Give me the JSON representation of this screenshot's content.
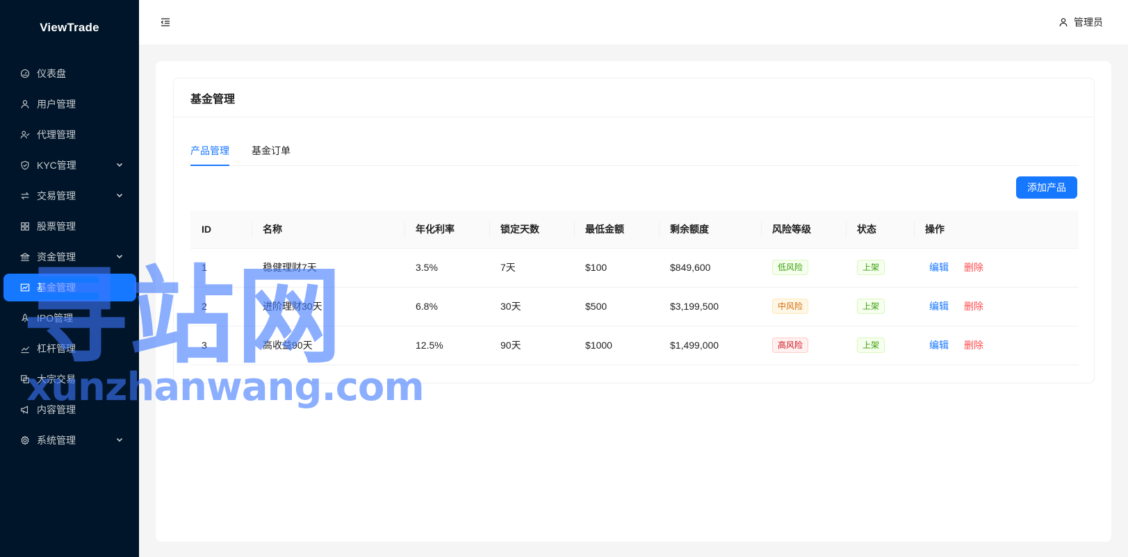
{
  "brand": "ViewTrade",
  "sidebar": {
    "items": [
      {
        "label": "仪表盘",
        "icon": "dashboard-icon",
        "has_children": false,
        "active": false
      },
      {
        "label": "用户管理",
        "icon": "user-icon",
        "has_children": false,
        "active": false
      },
      {
        "label": "代理管理",
        "icon": "agent-icon",
        "has_children": false,
        "active": false
      },
      {
        "label": "KYC管理",
        "icon": "shield-icon",
        "has_children": true,
        "active": false
      },
      {
        "label": "交易管理",
        "icon": "swap-icon",
        "has_children": true,
        "active": false
      },
      {
        "label": "股票管理",
        "icon": "grid-icon",
        "has_children": false,
        "active": false
      },
      {
        "label": "资金管理",
        "icon": "bank-icon",
        "has_children": true,
        "active": false
      },
      {
        "label": "基金管理",
        "icon": "stock-chart-icon",
        "has_children": false,
        "active": true
      },
      {
        "label": "IPO管理",
        "icon": "rocket-icon",
        "has_children": false,
        "active": false
      },
      {
        "label": "杠杆管理",
        "icon": "line-chart-icon",
        "has_children": false,
        "active": false
      },
      {
        "label": "大宗交易",
        "icon": "block-icon",
        "has_children": false,
        "active": false
      },
      {
        "label": "内容管理",
        "icon": "notification-icon",
        "has_children": false,
        "active": false
      },
      {
        "label": "系统管理",
        "icon": "setting-icon",
        "has_children": true,
        "active": false
      }
    ]
  },
  "header": {
    "user_label": "管理员"
  },
  "card": {
    "title": "基金管理"
  },
  "tabs": [
    {
      "label": "产品管理",
      "active": true
    },
    {
      "label": "基金订单",
      "active": false
    }
  ],
  "toolbar": {
    "add_label": "添加产品"
  },
  "table": {
    "columns": [
      "ID",
      "名称",
      "年化利率",
      "锁定天数",
      "最低金额",
      "剩余额度",
      "风险等级",
      "状态",
      "操作"
    ],
    "rows": [
      {
        "id": "1",
        "name": "稳健理财7天",
        "rate": "3.5%",
        "days": "7天",
        "min": "$100",
        "remaining": "$849,600",
        "risk": "低风险",
        "risk_color": "green",
        "status": "上架",
        "edit": "编辑",
        "delete": "删除"
      },
      {
        "id": "2",
        "name": "进阶理财30天",
        "rate": "6.8%",
        "days": "30天",
        "min": "$500",
        "remaining": "$3,199,500",
        "risk": "中风险",
        "risk_color": "orange",
        "status": "上架",
        "edit": "编辑",
        "delete": "删除"
      },
      {
        "id": "3",
        "name": "高收益90天",
        "rate": "12.5%",
        "days": "90天",
        "min": "$1000",
        "remaining": "$1,499,000",
        "risk": "高风险",
        "risk_color": "red",
        "status": "上架",
        "edit": "编辑",
        "delete": "删除"
      }
    ]
  },
  "watermark": {
    "cn": "寻站网",
    "en": "xunzhanwang.com"
  },
  "colors": {
    "sidebar_bg": "#001529",
    "accent": "#1677ff",
    "danger": "#ff4d4f"
  }
}
